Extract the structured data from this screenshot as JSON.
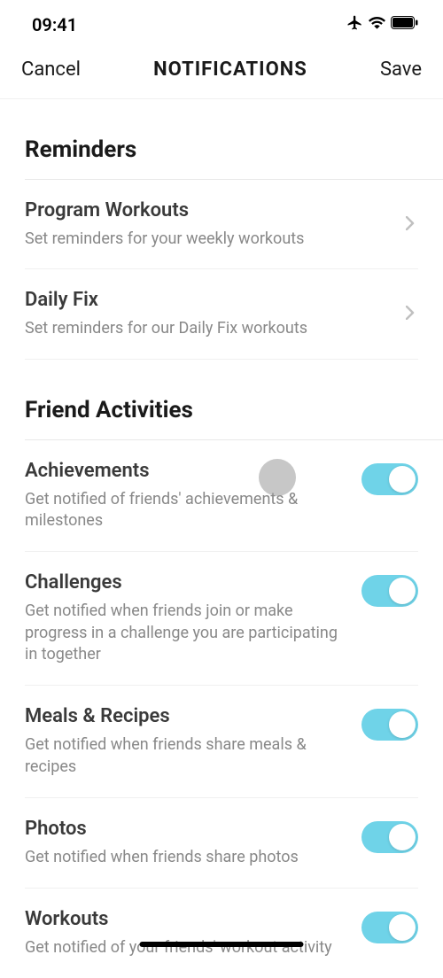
{
  "statusBar": {
    "time": "09:41"
  },
  "nav": {
    "cancel": "Cancel",
    "title": "NOTIFICATIONS",
    "save": "Save"
  },
  "sections": {
    "reminders": {
      "title": "Reminders",
      "items": [
        {
          "title": "Program Workouts",
          "desc": "Set reminders for your weekly workouts"
        },
        {
          "title": "Daily Fix",
          "desc": "Set reminders for our Daily Fix workouts"
        }
      ]
    },
    "friendActivities": {
      "title": "Friend Activities",
      "items": [
        {
          "title": "Achievements",
          "desc": "Get notified of friends' achievements & milestones",
          "enabled": true
        },
        {
          "title": "Challenges",
          "desc": "Get notified when friends join or make progress in a challenge you are participating in together",
          "enabled": true
        },
        {
          "title": "Meals & Recipes",
          "desc": "Get notified when friends share meals & recipes",
          "enabled": true
        },
        {
          "title": "Photos",
          "desc": "Get notified when friends share photos",
          "enabled": true
        },
        {
          "title": "Workouts",
          "desc": "Get notified of your friends' workout activity",
          "enabled": true
        }
      ]
    }
  }
}
